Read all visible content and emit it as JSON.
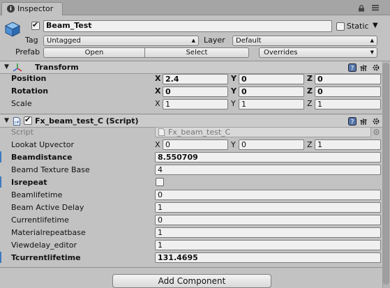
{
  "tab": {
    "label": "Inspector"
  },
  "gameobject": {
    "name": "Beam_Test",
    "active": true,
    "static_label": "Static",
    "static_checked": false,
    "tag_label": "Tag",
    "tag_value": "Untagged",
    "layer_label": "Layer",
    "layer_value": "Default",
    "prefab_label": "Prefab",
    "prefab_open": "Open",
    "prefab_select": "Select",
    "prefab_overrides": "Overrides"
  },
  "transform": {
    "title": "Transform",
    "rows": [
      {
        "label": "Position",
        "x": "2.4",
        "y": "0",
        "z": "0"
      },
      {
        "label": "Rotation",
        "x": "0",
        "y": "0",
        "z": "0"
      },
      {
        "label": "Scale",
        "x": "1",
        "y": "1",
        "z": "1"
      }
    ]
  },
  "script_component": {
    "title": "Fx_beam_test_C (Script)",
    "enabled": true,
    "script_label": "Script",
    "script_value": "Fx_beam_test_C",
    "lookat_label": "Lookat Upvector",
    "lookat": {
      "x": "0",
      "y": "0",
      "z": "1"
    },
    "fields": [
      {
        "label": "Beamdistance",
        "value": "8.550709"
      },
      {
        "label": "Beamd Texture Base",
        "value": "4"
      },
      {
        "label": "Isrepeat",
        "value": ""
      },
      {
        "label": "Beamlifetime",
        "value": "0"
      },
      {
        "label": "Beam Active Delay",
        "value": "1"
      },
      {
        "label": "Currentlifetime",
        "value": "0"
      },
      {
        "label": "Materialrepeatbase",
        "value": "1"
      },
      {
        "label": "Viewdelay_editor",
        "value": "1"
      },
      {
        "label": "Tcurrentlifetime",
        "value": "131.4695"
      }
    ]
  },
  "axes": {
    "x": "X",
    "y": "Y",
    "z": "Z"
  },
  "add_component": "Add Component"
}
